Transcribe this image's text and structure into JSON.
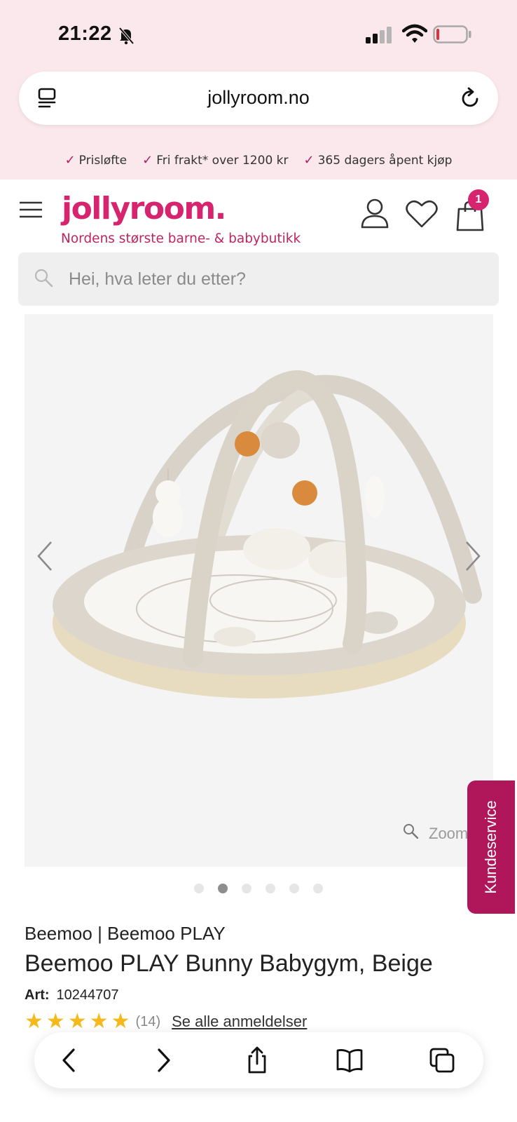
{
  "status_bar": {
    "time": "21:22"
  },
  "browser": {
    "url": "jollyroom.no"
  },
  "usp": [
    {
      "label": "Prisløfte"
    },
    {
      "label": "Fri frakt* over 1200 kr"
    },
    {
      "label": "365 dagers åpent kjøp"
    }
  ],
  "header": {
    "logo": "jollyroom.",
    "tagline": "Nordens største barne- & babybutikk",
    "cart_count": "1"
  },
  "search": {
    "placeholder": "Hei, hva leter du etter?"
  },
  "gallery": {
    "zoom_label": "Zoom",
    "image_count": 6,
    "active_index": 1
  },
  "kundeservice": {
    "label": "Kundeservice"
  },
  "product": {
    "brand": "Beemoo | Beemoo PLAY",
    "title": "Beemoo PLAY Bunny Babygym, Beige",
    "art_label": "Art:",
    "art_number": "10244707",
    "rating_stars": 5,
    "review_count": "(14)",
    "reviews_link": "Se alle anmeldelser"
  },
  "colors": {
    "brand_pink": "#d6246e",
    "kundeservice_bg": "#b0175a",
    "top_bg": "#fbe8ec",
    "star": "#f6b91c"
  },
  "icons": [
    "bell-slash-icon",
    "signal-icon",
    "wifi-icon",
    "battery-icon",
    "reader-icon",
    "reload-icon",
    "menu-icon",
    "user-icon",
    "heart-icon",
    "bag-icon",
    "search-icon",
    "chevron-left-icon",
    "chevron-right-icon",
    "zoom-icon",
    "back-icon",
    "forward-icon",
    "share-icon",
    "bookmarks-icon",
    "tabs-icon"
  ]
}
